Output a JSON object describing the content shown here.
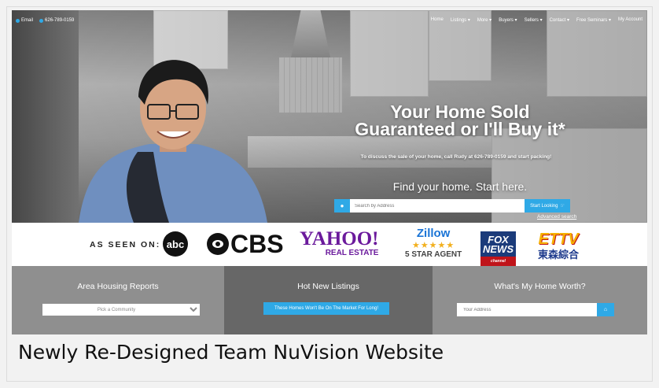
{
  "caption": "Newly Re-Designed Team NuVision Website",
  "topbar": {
    "email_label": "Email",
    "phone_label": "626-789-0159",
    "nav": [
      "Home",
      "Listings ▾",
      "More ▾",
      "Buyers ▾",
      "Sellers ▾",
      "Contact ▾",
      "Free Seminars ▾",
      "My Account"
    ]
  },
  "hero": {
    "headline_line1": "Your Home Sold",
    "headline_line2": "Guaranteed or I'll Buy it*",
    "subtext": "To discuss the sale of your home, call Rudy at 626-789-0159 and start packing!",
    "find_text": "Find your home. Start here.",
    "search_placeholder": "Search by Address",
    "search_button": "Start Looking",
    "advanced_search": "Advanced search"
  },
  "media": {
    "seen_on": "AS SEEN ON:",
    "abc": "abc",
    "cbs": "CBS",
    "yahoo_line1": "YAHOO!",
    "yahoo_line2": "REAL ESTATE",
    "zillow_name": "Zillow",
    "zillow_stars": "★★★★★",
    "zillow_agent": "5 STAR AGENT",
    "fox_line1": "FOX",
    "fox_line2": "NEWS",
    "fox_line3": "channel",
    "ettv_line1": "ETTV",
    "ettv_line2": "東森綜合"
  },
  "panels": {
    "area_title": "Area Housing Reports",
    "area_select": "Pick a Community",
    "hot_title": "Hot New Listings",
    "hot_button": "These Homes Won't Be On The Market For Long!",
    "worth_title": "What's My Home Worth?",
    "worth_placeholder": "Your Address"
  },
  "colors": {
    "accent": "#2fa9e6",
    "panel_light": "#8f8f8f",
    "panel_dark": "#676767"
  }
}
